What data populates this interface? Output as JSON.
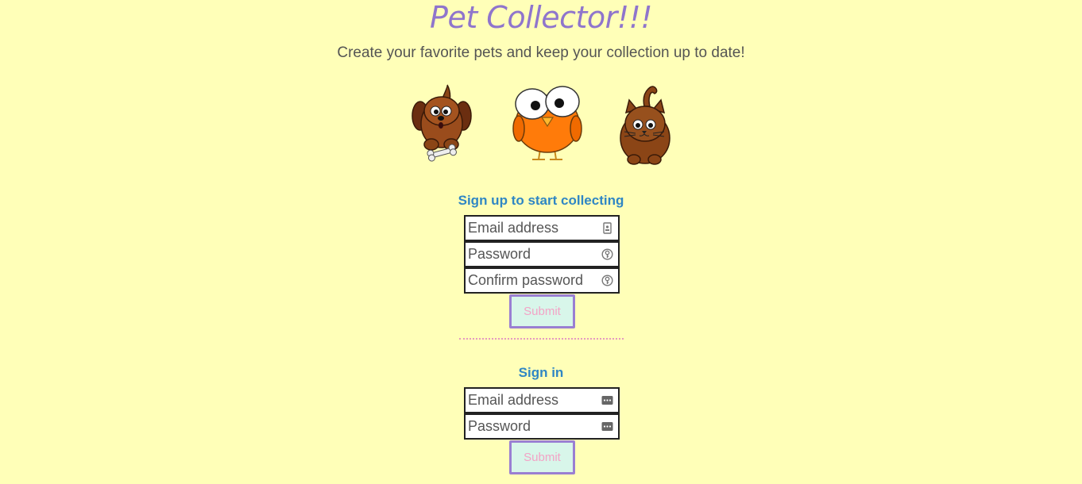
{
  "header": {
    "title": "Pet Collector!!!",
    "subtitle": "Create your favorite pets and keep your collection up to date!"
  },
  "pets": [
    {
      "name": "dog"
    },
    {
      "name": "bird"
    },
    {
      "name": "cat"
    }
  ],
  "signup": {
    "heading": "Sign up to start collecting",
    "email_placeholder": "Email address",
    "password_placeholder": "Password",
    "confirm_placeholder": "Confirm password",
    "submit_label": "Submit",
    "email_icon": "contact-card-icon",
    "password_icon": "key-icon"
  },
  "signin": {
    "heading": "Sign in",
    "email_placeholder": "Email address",
    "password_placeholder": "Password",
    "submit_label": "Submit",
    "field_icon": "password-manager-icon"
  },
  "colors": {
    "background": "#ffffb8",
    "title": "#8f75cc",
    "heading": "#2f86c4",
    "submit_border": "#9a7fd2",
    "submit_bg": "#d8f6ea",
    "submit_text": "#f3a3c6",
    "divider": "#e49ac0"
  }
}
